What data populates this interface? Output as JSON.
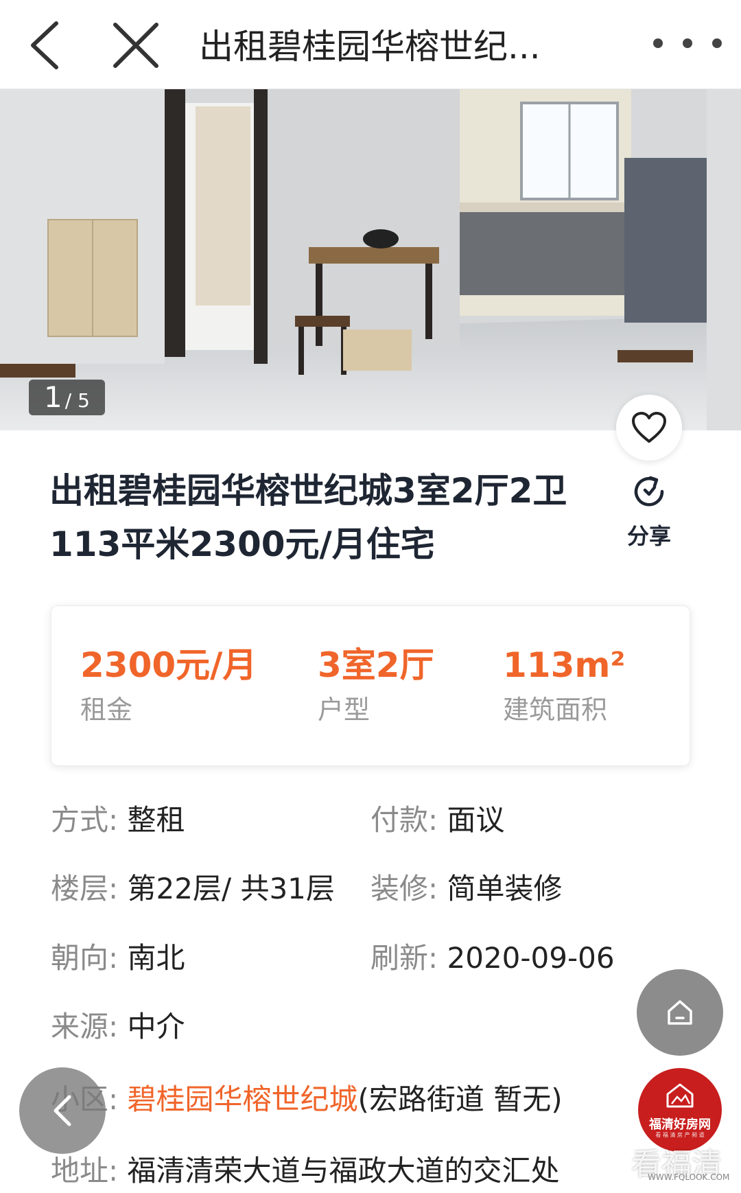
{
  "nav": {
    "title": "出租碧桂园华榕世纪...",
    "back_icon": "chevron-left-icon",
    "close_icon": "close-icon",
    "more_icon": "more-dots-icon"
  },
  "gallery": {
    "current": "1",
    "total": "/ 5",
    "favorite_icon": "heart-icon"
  },
  "listing": {
    "title": "出租碧桂园华榕世纪城3室2厅2卫113平米2300元/月住宅",
    "share_label": "分享",
    "share_icon": "share-icon"
  },
  "summary": [
    {
      "value": "2300元/月",
      "label": "租金"
    },
    {
      "value": "3室2厅",
      "label": "户型"
    },
    {
      "value": "113m²",
      "label": "建筑面积"
    }
  ],
  "details": {
    "mode_k": "方式:",
    "mode_v": "整租",
    "pay_k": "付款:",
    "pay_v": "面议",
    "floor_k": "楼层:",
    "floor_v": "第22层/ 共31层",
    "deco_k": "装修:",
    "deco_v": "简单装修",
    "orient_k": "朝向:",
    "orient_v": "南北",
    "refresh_k": "刷新:",
    "refresh_v": "2020-09-06",
    "source_k": "来源:",
    "source_v": "中介",
    "community_k": "小区:",
    "community_v": "碧桂园华榕世纪城",
    "community_extra": "(宏路街道 暂无)",
    "addr_k": "地址:",
    "addr_v": "福清清荣大道与福政大道的交汇处"
  },
  "floating": {
    "home_icon": "home-icon",
    "back_icon": "chevron-left-icon",
    "brand_name": "福清好房网",
    "brand_sub": "看 福 清 房 产 频 道",
    "watermark": "看福清",
    "watermark_url": "WWW.FQLOOK.COM"
  },
  "colors": {
    "accent": "#f0652a",
    "title": "#1f2633",
    "label_gray": "#8a8a8a",
    "brand_red": "#c81e1e"
  }
}
